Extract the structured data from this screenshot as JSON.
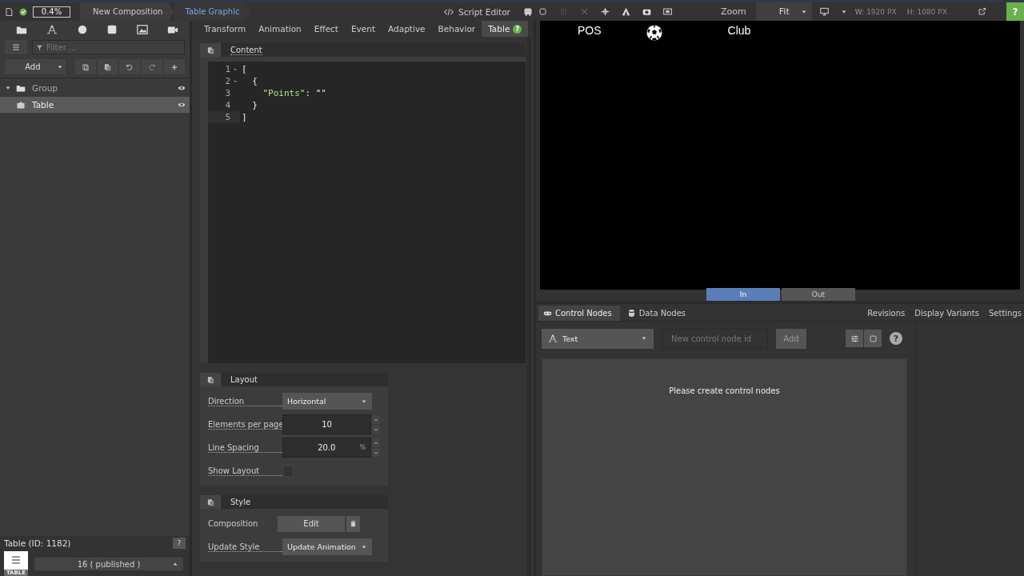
{
  "topbar": {
    "zoom_percent": "0.4%",
    "breadcrumbs": [
      {
        "label": "New Composition",
        "selected": false
      },
      {
        "label": "Table Graphic",
        "selected": true
      }
    ],
    "script_editor": "Script Editor"
  },
  "sidebar": {
    "filter_placeholder": "Filter ...",
    "add_label": "Add",
    "tree": [
      {
        "label": "Group",
        "kind": "group",
        "selected": false,
        "expanded": true,
        "children": [
          {
            "label": "Table",
            "kind": "item",
            "selected": true
          }
        ]
      }
    ],
    "footer_title": "Table (ID: 1182)",
    "help": "?",
    "thumb_label": "TABLE",
    "version": "16 ( published )"
  },
  "tabs": [
    {
      "label": "Transform",
      "selected": false
    },
    {
      "label": "Animation",
      "selected": false
    },
    {
      "label": "Effect",
      "selected": false
    },
    {
      "label": "Event",
      "selected": false
    },
    {
      "label": "Adaptive",
      "selected": false
    },
    {
      "label": "Behavior",
      "selected": false
    },
    {
      "label": "Table",
      "selected": true,
      "badge": "?"
    }
  ],
  "content": {
    "title": "Content",
    "lines": [
      {
        "number": "1",
        "foldable": true,
        "text": "["
      },
      {
        "number": "2",
        "foldable": true,
        "text": "  {"
      },
      {
        "number": "3",
        "foldable": false,
        "text": "    \"Points\": \"\""
      },
      {
        "number": "4",
        "foldable": false,
        "text": "  }"
      },
      {
        "number": "5",
        "foldable": false,
        "text": "]"
      }
    ]
  },
  "layout": {
    "title": "Layout",
    "rows": [
      {
        "kind": "select",
        "label": "Direction",
        "value": "Horizontal"
      },
      {
        "kind": "number",
        "label": "Elements per page",
        "value": "10"
      },
      {
        "kind": "number",
        "label": "Line Spacing",
        "value": "20.0",
        "unit": "%"
      },
      {
        "kind": "checkbox",
        "label": "Show Layout",
        "checked": false
      }
    ]
  },
  "style": {
    "title": "Style",
    "rows": [
      {
        "kind": "edit",
        "label": "Composition",
        "value": "Edit"
      },
      {
        "kind": "select",
        "label": "Update Style",
        "value": "Update Animation"
      }
    ]
  },
  "preview_toolbar": {
    "zoom_label": "Zoom",
    "zoom_value": "Fit",
    "w_label": "W:",
    "w_value": "1920",
    "w_unit": "PX",
    "h_label": "H:",
    "h_value": "1080",
    "h_unit": "PX",
    "help": "?"
  },
  "preview": {
    "texts": [
      "POS",
      "Club"
    ]
  },
  "transition_tabs": [
    {
      "label": "In",
      "selected": true
    },
    {
      "label": "Out",
      "selected": false
    }
  ],
  "node_tabs": [
    {
      "label": "Control Nodes",
      "selected": true
    },
    {
      "label": "Data Nodes",
      "selected": false
    }
  ],
  "right_links": [
    "Revisions",
    "Display Variants",
    "Settings"
  ],
  "control": {
    "type_value": "Text",
    "id_placeholder": "New control node id",
    "add": "Add",
    "help": "?",
    "empty_message": "Please create control nodes"
  }
}
